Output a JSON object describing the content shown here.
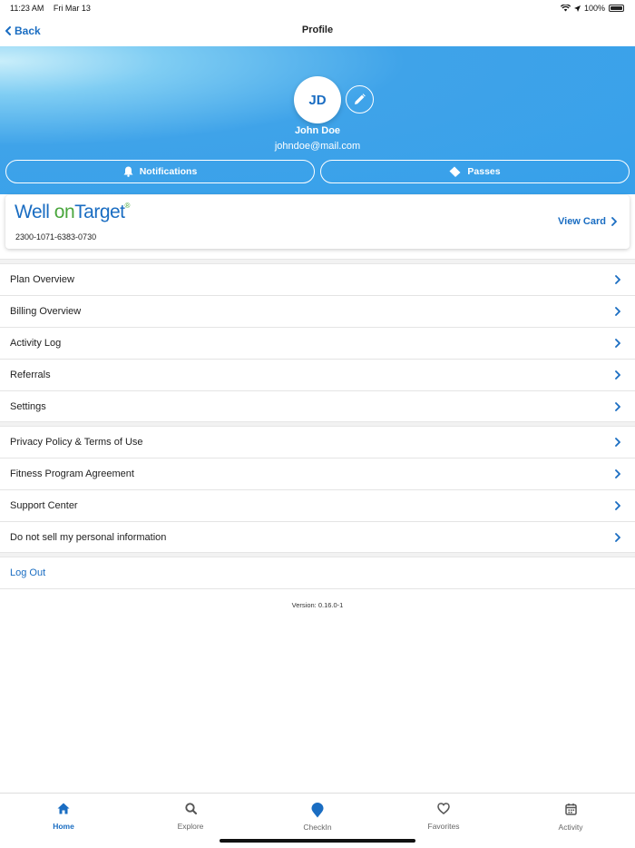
{
  "status_bar": {
    "time": "11:23 AM",
    "date": "Fri Mar 13",
    "battery": "100%"
  },
  "nav": {
    "back_label": "Back",
    "title": "Profile"
  },
  "profile": {
    "initials": "JD",
    "name": "John Doe",
    "email": "johndoe@mail.com"
  },
  "actions": {
    "notifications_label": "Notifications",
    "passes_label": "Passes"
  },
  "card": {
    "logo_well": "Well ",
    "logo_on": "on",
    "logo_target": "Target",
    "logo_reg": "®",
    "number": "2300-1071-6383-0730",
    "view_label": "View Card"
  },
  "menu_group1": [
    {
      "label": "Plan Overview"
    },
    {
      "label": "Billing Overview"
    },
    {
      "label": "Activity Log"
    },
    {
      "label": "Referrals"
    },
    {
      "label": "Settings"
    }
  ],
  "menu_group2": [
    {
      "label": "Privacy Policy & Terms of Use"
    },
    {
      "label": "Fitness Program Agreement"
    },
    {
      "label": "Support Center"
    },
    {
      "label": "Do not sell my personal information"
    }
  ],
  "logout_label": "Log Out",
  "version": "Version: 0.16.0-1",
  "tabs": [
    {
      "label": "Home",
      "icon": "home-icon"
    },
    {
      "label": "Explore",
      "icon": "search-icon"
    },
    {
      "label": "CheckIn",
      "icon": "map-pin-icon"
    },
    {
      "label": "Favorites",
      "icon": "heart-icon"
    },
    {
      "label": "Activity",
      "icon": "calendar-icon"
    }
  ],
  "colors": {
    "brand_blue": "#1a6dc2",
    "header_blue": "#36a0ea",
    "logo_green": "#4aa63d"
  }
}
